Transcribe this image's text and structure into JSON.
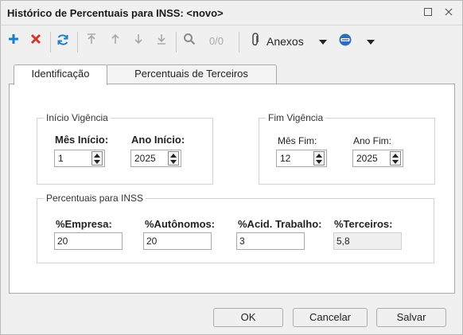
{
  "window": {
    "title": "Histórico de Percentuais para INSS: <novo>"
  },
  "toolbar": {
    "annex_label": "Anexos",
    "page_counter": "0/0"
  },
  "tabs": [
    {
      "label": "Identificação"
    },
    {
      "label": "Percentuais de Terceiros"
    }
  ],
  "inicio": {
    "group_title": "Início Vigência",
    "mes_label": "Mês Início:",
    "mes_value": "1",
    "ano_label": "Ano Início:",
    "ano_value": "2025"
  },
  "fim": {
    "group_title": "Fim Vigência",
    "mes_label": "Mês Fim:",
    "mes_value": "12",
    "ano_label": "Ano Fim:",
    "ano_value": "2025"
  },
  "percentuais": {
    "group_title": "Percentuais para INSS",
    "empresa_label": "%Empresa:",
    "empresa_value": "20",
    "autonomos_label": "%Autônomos:",
    "autonomos_value": "20",
    "acid_label": "%Acid. Trabalho:",
    "acid_value": "3",
    "terceiros_label": "%Terceiros:",
    "terceiros_value": "5,8"
  },
  "buttons": {
    "ok": "OK",
    "cancel": "Cancelar",
    "save": "Salvar"
  },
  "colors": {
    "add": "#1e7fc8",
    "delete": "#d9342b",
    "refresh": "#1e7fc8",
    "attach": "#444444",
    "accent": "#2a6ebb"
  },
  "icons": [
    "add-icon",
    "delete-icon",
    "refresh-icon",
    "first-icon",
    "prev-icon",
    "next-icon",
    "last-icon",
    "search-icon",
    "attach-icon",
    "dropdown-arrow-icon",
    "link-icon",
    "maximize-icon",
    "close-icon"
  ]
}
